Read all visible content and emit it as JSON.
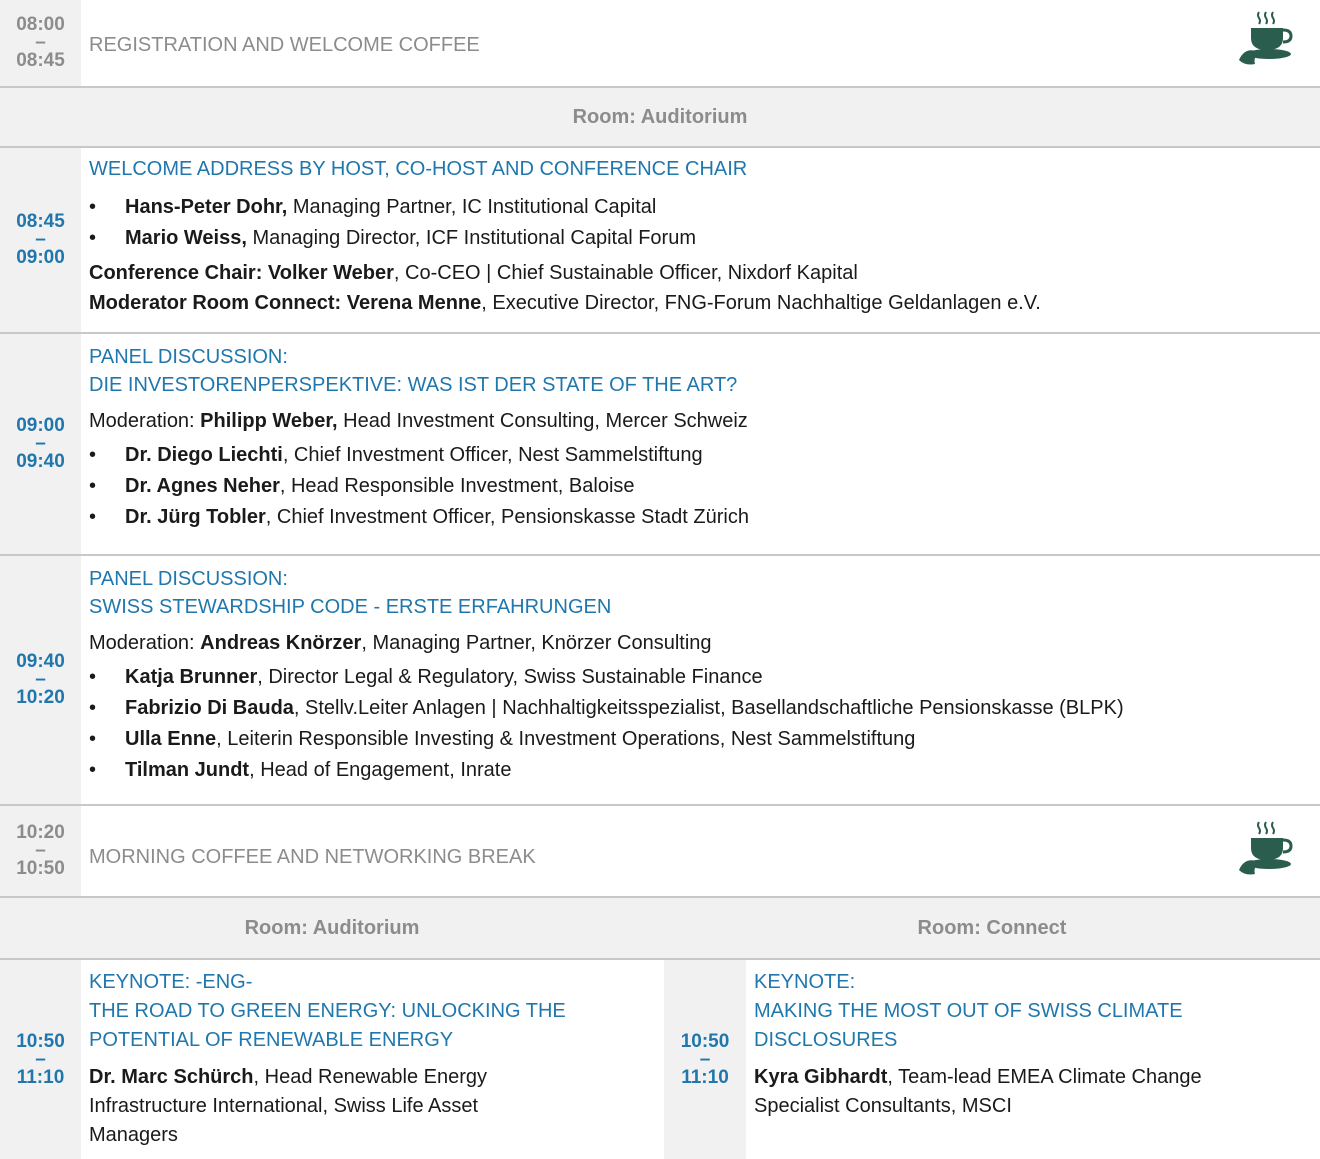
{
  "blocks": {
    "registration": {
      "start": "08:00",
      "end": "08:45",
      "sep": "–",
      "title": "REGISTRATION AND WELCOME COFFEE"
    },
    "room1": "Room: Auditorium",
    "welcome": {
      "start": "08:45",
      "end": "09:00",
      "sep": "–",
      "title": "WELCOME ADDRESS BY HOST, CO-HOST AND CONFERENCE CHAIR",
      "speakers": [
        {
          "name": "Hans-Peter Dohr,",
          "role": " Managing Partner, IC Institutional Capital"
        },
        {
          "name": "Mario Weiss,",
          "role": " Managing Director, ICF Institutional Capital Forum"
        }
      ],
      "chair_label": "Conference Chair: Volker Weber",
      "chair_role": ", Co-CEO | Chief Sustainable Officer, Nixdorf Kapital",
      "moderator_label": "Moderator Room Connect: Verena Menne",
      "moderator_role": ", Executive Director, FNG-Forum Nachhaltige Geldanlagen e.V."
    },
    "panel1": {
      "start": "09:00",
      "end": "09:40",
      "sep": "–",
      "title1": "PANEL DISCUSSION:",
      "title2": "DIE INVESTORENPERSPEKTIVE: WAS IST DER STATE OF THE ART?",
      "mod_prefix": "Moderation: ",
      "mod_name": "Philipp Weber,",
      "mod_role": " Head Investment Consulting, Mercer Schweiz",
      "speakers": [
        {
          "name": "Dr. Diego Liechti",
          "role": ", Chief Investment Officer, Nest Sammelstiftung"
        },
        {
          "name": "Dr. Agnes Neher",
          "role": ", Head Responsible Investment, Baloise"
        },
        {
          "name": "Dr. Jürg Tobler",
          "role": ", Chief Investment Officer, Pensionskasse Stadt Zürich"
        }
      ]
    },
    "panel2": {
      "start": "09:40",
      "end": "10:20",
      "sep": "–",
      "title1": "PANEL DISCUSSION:",
      "title2": "SWISS STEWARDSHIP CODE - ERSTE ERFAHRUNGEN",
      "mod_prefix": "Moderation: ",
      "mod_name": "Andreas Knörzer",
      "mod_role": ", Managing Partner, Knörzer Consulting",
      "speakers": [
        {
          "name": "Katja Brunner",
          "role": ", Director Legal & Regulatory, Swiss Sustainable Finance"
        },
        {
          "name": "Fabrizio Di Bauda",
          "role": ", Stellv.Leiter Anlagen | Nachhaltigkeitsspezialist, Basellandschaftliche Pensionskasse (BLPK)"
        },
        {
          "name": "Ulla Enne",
          "role": ", Leiterin Responsible Investing & Investment Operations, Nest Sammelstiftung"
        },
        {
          "name": "Tilman Jundt",
          "role": ", Head of Engagement, Inrate"
        }
      ]
    },
    "break": {
      "start": "10:20",
      "end": "10:50",
      "sep": "–",
      "title": "MORNING COFFEE AND NETWORKING BREAK"
    },
    "room_left": "Room: Auditorium",
    "room_right": "Room: Connect",
    "keynote_left": {
      "start": "10:50",
      "end": "11:10",
      "sep": "–",
      "title1": "KEYNOTE: -ENG-",
      "title2": "THE ROAD TO GREEN ENERGY: UNLOCKING THE",
      "title3": "POTENTIAL OF RENEWABLE ENERGY",
      "speaker_name": "Dr. Marc Schürch",
      "speaker_role1": ", Head Renewable Energy",
      "speaker_role2": "Infrastructure International, Swiss Life Asset",
      "speaker_role3": "Managers"
    },
    "keynote_right": {
      "start": "10:50",
      "end": "11:10",
      "sep": "–",
      "title1": "KEYNOTE:",
      "title2": "MAKING THE MOST OUT OF SWISS CLIMATE",
      "title3": "DISCLOSURES",
      "speaker_name": "Kyra Gibhardt",
      "speaker_role1": ", Team-lead EMEA Climate Change",
      "speaker_role2": "Specialist Consultants, MSCI"
    }
  },
  "icons": {
    "coffee": "coffee-cup-icon",
    "accent": "#1f77ad",
    "grey": "#8c8c8c"
  }
}
